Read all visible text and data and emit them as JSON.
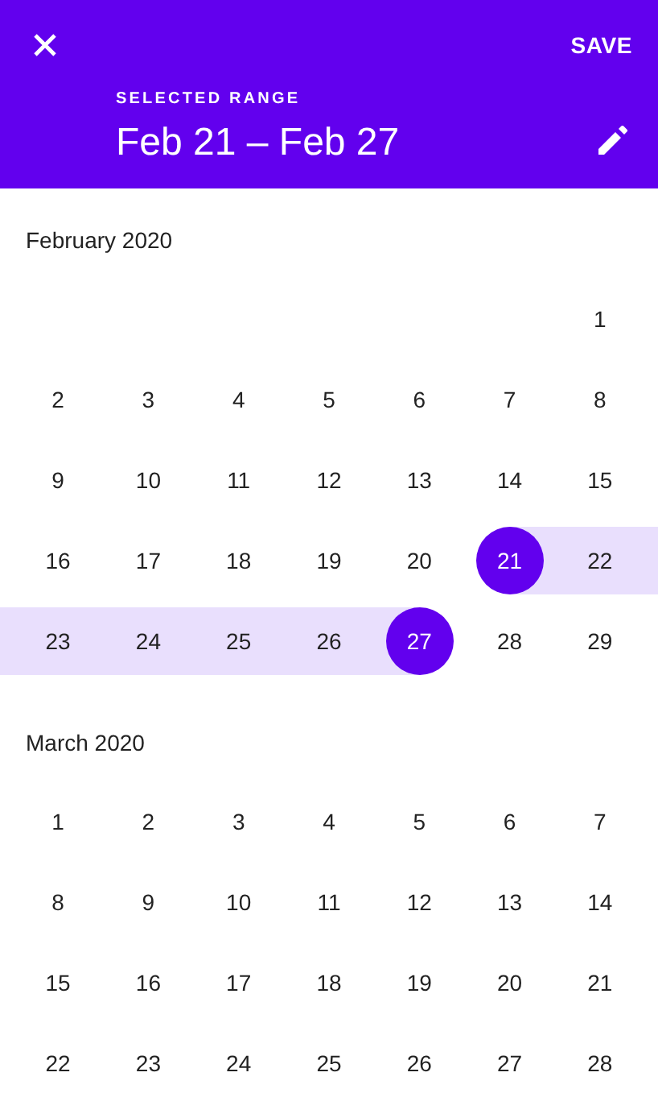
{
  "header": {
    "action": "SAVE",
    "overline": "SELECTED RANGE",
    "title": "Feb 21 – Feb 27"
  },
  "months": [
    {
      "title": "February 2020",
      "weeks": [
        [
          {
            "kind": "blank"
          },
          {
            "kind": "blank"
          },
          {
            "kind": "blank"
          },
          {
            "kind": "blank"
          },
          {
            "kind": "blank"
          },
          {
            "kind": "blank"
          },
          {
            "kind": "day",
            "day": "1",
            "selected": false,
            "in_range": false
          }
        ],
        [
          {
            "kind": "day",
            "day": "2",
            "selected": false,
            "in_range": false
          },
          {
            "kind": "day",
            "day": "3",
            "selected": false,
            "in_range": false
          },
          {
            "kind": "day",
            "day": "4",
            "selected": false,
            "in_range": false
          },
          {
            "kind": "day",
            "day": "5",
            "selected": false,
            "in_range": false
          },
          {
            "kind": "day",
            "day": "6",
            "selected": false,
            "in_range": false
          },
          {
            "kind": "day",
            "day": "7",
            "selected": false,
            "in_range": false
          },
          {
            "kind": "day",
            "day": "8",
            "selected": false,
            "in_range": false
          }
        ],
        [
          {
            "kind": "day",
            "day": "9",
            "selected": false,
            "in_range": false
          },
          {
            "kind": "day",
            "day": "10",
            "selected": false,
            "in_range": false
          },
          {
            "kind": "day",
            "day": "11",
            "selected": false,
            "in_range": false
          },
          {
            "kind": "day",
            "day": "12",
            "selected": false,
            "in_range": false
          },
          {
            "kind": "day",
            "day": "13",
            "selected": false,
            "in_range": false
          },
          {
            "kind": "day",
            "day": "14",
            "selected": false,
            "in_range": false
          },
          {
            "kind": "day",
            "day": "15",
            "selected": false,
            "in_range": false
          }
        ],
        [
          {
            "kind": "day",
            "day": "16",
            "selected": false,
            "in_range": false
          },
          {
            "kind": "day",
            "day": "17",
            "selected": false,
            "in_range": false
          },
          {
            "kind": "day",
            "day": "18",
            "selected": false,
            "in_range": false
          },
          {
            "kind": "day",
            "day": "19",
            "selected": false,
            "in_range": false
          },
          {
            "kind": "day",
            "day": "20",
            "selected": false,
            "in_range": false
          },
          {
            "kind": "day",
            "day": "21",
            "selected": true,
            "in_range": true
          },
          {
            "kind": "day",
            "day": "22",
            "selected": false,
            "in_range": true
          }
        ],
        [
          {
            "kind": "day",
            "day": "23",
            "selected": false,
            "in_range": true
          },
          {
            "kind": "day",
            "day": "24",
            "selected": false,
            "in_range": true
          },
          {
            "kind": "day",
            "day": "25",
            "selected": false,
            "in_range": true
          },
          {
            "kind": "day",
            "day": "26",
            "selected": false,
            "in_range": true
          },
          {
            "kind": "day",
            "day": "27",
            "selected": true,
            "in_range": true
          },
          {
            "kind": "day",
            "day": "28",
            "selected": false,
            "in_range": false
          },
          {
            "kind": "day",
            "day": "29",
            "selected": false,
            "in_range": false
          }
        ]
      ]
    },
    {
      "title": "March 2020",
      "weeks": [
        [
          {
            "kind": "day",
            "day": "1",
            "selected": false,
            "in_range": false
          },
          {
            "kind": "day",
            "day": "2",
            "selected": false,
            "in_range": false
          },
          {
            "kind": "day",
            "day": "3",
            "selected": false,
            "in_range": false
          },
          {
            "kind": "day",
            "day": "4",
            "selected": false,
            "in_range": false
          },
          {
            "kind": "day",
            "day": "5",
            "selected": false,
            "in_range": false
          },
          {
            "kind": "day",
            "day": "6",
            "selected": false,
            "in_range": false
          },
          {
            "kind": "day",
            "day": "7",
            "selected": false,
            "in_range": false
          }
        ],
        [
          {
            "kind": "day",
            "day": "8",
            "selected": false,
            "in_range": false
          },
          {
            "kind": "day",
            "day": "9",
            "selected": false,
            "in_range": false
          },
          {
            "kind": "day",
            "day": "10",
            "selected": false,
            "in_range": false
          },
          {
            "kind": "day",
            "day": "11",
            "selected": false,
            "in_range": false
          },
          {
            "kind": "day",
            "day": "12",
            "selected": false,
            "in_range": false
          },
          {
            "kind": "day",
            "day": "13",
            "selected": false,
            "in_range": false
          },
          {
            "kind": "day",
            "day": "14",
            "selected": false,
            "in_range": false
          }
        ],
        [
          {
            "kind": "day",
            "day": "15",
            "selected": false,
            "in_range": false
          },
          {
            "kind": "day",
            "day": "16",
            "selected": false,
            "in_range": false
          },
          {
            "kind": "day",
            "day": "17",
            "selected": false,
            "in_range": false
          },
          {
            "kind": "day",
            "day": "18",
            "selected": false,
            "in_range": false
          },
          {
            "kind": "day",
            "day": "19",
            "selected": false,
            "in_range": false
          },
          {
            "kind": "day",
            "day": "20",
            "selected": false,
            "in_range": false
          },
          {
            "kind": "day",
            "day": "21",
            "selected": false,
            "in_range": false
          }
        ],
        [
          {
            "kind": "day",
            "day": "22",
            "selected": false,
            "in_range": false
          },
          {
            "kind": "day",
            "day": "23",
            "selected": false,
            "in_range": false
          },
          {
            "kind": "day",
            "day": "24",
            "selected": false,
            "in_range": false
          },
          {
            "kind": "day",
            "day": "25",
            "selected": false,
            "in_range": false
          },
          {
            "kind": "day",
            "day": "26",
            "selected": false,
            "in_range": false
          },
          {
            "kind": "day",
            "day": "27",
            "selected": false,
            "in_range": false
          },
          {
            "kind": "day",
            "day": "28",
            "selected": false,
            "in_range": false
          }
        ]
      ]
    }
  ]
}
